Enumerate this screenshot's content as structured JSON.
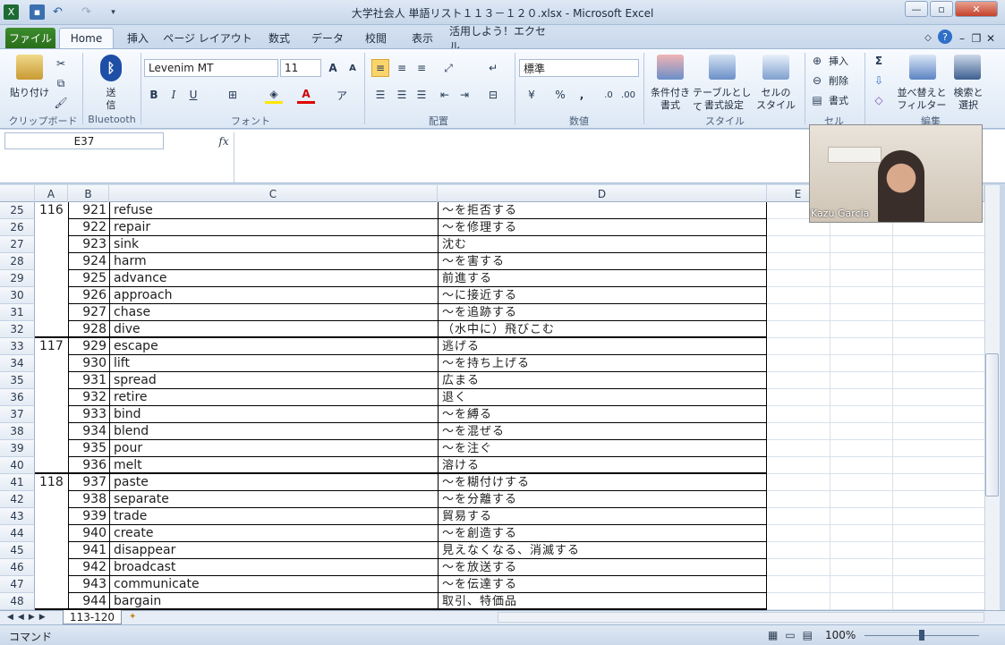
{
  "window": {
    "title": "大学社会人  単語リスト１１３－１２０.xlsx  -  Microsoft Excel"
  },
  "ribbon_tabs": [
    "ファイル",
    "Home",
    "挿入",
    "ページ レイアウト",
    "数式",
    "データ",
    "校閲",
    "表示",
    "活用しよう！エクセル"
  ],
  "ribbon": {
    "clipboard": {
      "paste_label": "貼り付け",
      "group_label": "クリップボード"
    },
    "bluetooth": {
      "send_label1": "送",
      "send_label2": "信",
      "group_label": "Bluetooth"
    },
    "font": {
      "name": "Levenim MT",
      "size": "11",
      "bold": "B",
      "italic": "I",
      "underline": "U",
      "grow": "A",
      "shrink": "A",
      "group_label": "フォント"
    },
    "alignment": {
      "group_label": "配置"
    },
    "number": {
      "format": "標準",
      "percent": "%",
      "comma": ",",
      "group_label": "数値"
    },
    "styles": {
      "conditional1": "条件付き",
      "conditional2": "書式",
      "table1": "テーブルとして",
      "table2": "書式設定",
      "cell1": "セルの",
      "cell2": "スタイル",
      "group_label": "スタイル"
    },
    "cells": {
      "insert": "挿入",
      "delete": "削除",
      "format": "書式",
      "group_label": "セル"
    },
    "editing": {
      "sigma": "Σ",
      "sort1": "並べ替えと",
      "sort2": "フィルター",
      "find1": "検索と",
      "find2": "選択",
      "group_label": "編集"
    }
  },
  "formula_bar": {
    "name_box": "E37",
    "fx": "fx",
    "value": ""
  },
  "columns": [
    "A",
    "B",
    "C",
    "D",
    "E"
  ],
  "rows": [
    {
      "r": "25",
      "a": "116",
      "b": "921",
      "c": "refuse",
      "d": "～を拒否する"
    },
    {
      "r": "26",
      "a": "",
      "b": "922",
      "c": "repair",
      "d": "～を修理する"
    },
    {
      "r": "27",
      "a": "",
      "b": "923",
      "c": "sink",
      "d": "沈む"
    },
    {
      "r": "28",
      "a": "",
      "b": "924",
      "c": "harm",
      "d": "～を害する"
    },
    {
      "r": "29",
      "a": "",
      "b": "925",
      "c": "advance",
      "d": "前進する"
    },
    {
      "r": "30",
      "a": "",
      "b": "926",
      "c": "approach",
      "d": "～に接近する"
    },
    {
      "r": "31",
      "a": "",
      "b": "927",
      "c": "chase",
      "d": "～を追跡する"
    },
    {
      "r": "32",
      "a": "",
      "b": "928",
      "c": "dive",
      "d": "（水中に）飛びこむ"
    },
    {
      "r": "33",
      "a": "117",
      "b": "929",
      "c": "escape",
      "d": "逃げる"
    },
    {
      "r": "34",
      "a": "",
      "b": "930",
      "c": "lift",
      "d": "～を持ち上げる"
    },
    {
      "r": "35",
      "a": "",
      "b": "931",
      "c": "spread",
      "d": "広まる"
    },
    {
      "r": "36",
      "a": "",
      "b": "932",
      "c": "retire",
      "d": "退く"
    },
    {
      "r": "37",
      "a": "",
      "b": "933",
      "c": "bind",
      "d": "～を縛る"
    },
    {
      "r": "38",
      "a": "",
      "b": "934",
      "c": "blend",
      "d": "～を混ぜる"
    },
    {
      "r": "39",
      "a": "",
      "b": "935",
      "c": "pour",
      "d": "～を注ぐ"
    },
    {
      "r": "40",
      "a": "",
      "b": "936",
      "c": "melt",
      "d": "溶ける"
    },
    {
      "r": "41",
      "a": "118",
      "b": "937",
      "c": "paste",
      "d": "～を糊付けする"
    },
    {
      "r": "42",
      "a": "",
      "b": "938",
      "c": "separate",
      "d": "～を分離する"
    },
    {
      "r": "43",
      "a": "",
      "b": "939",
      "c": "trade",
      "d": "貿易する"
    },
    {
      "r": "44",
      "a": "",
      "b": "940",
      "c": "create",
      "d": "～を創造する"
    },
    {
      "r": "45",
      "a": "",
      "b": "941",
      "c": "disappear",
      "d": "見えなくなる、消滅する"
    },
    {
      "r": "46",
      "a": "",
      "b": "942",
      "c": "broadcast",
      "d": "～を放送する"
    },
    {
      "r": "47",
      "a": "",
      "b": "943",
      "c": "communicate",
      "d": "～を伝達する"
    },
    {
      "r": "48",
      "a": "",
      "b": "944",
      "c": "bargain",
      "d": "取引、特価品"
    }
  ],
  "sheet_tab": "113-120",
  "status": {
    "mode": "コマンド",
    "zoom": "100%"
  },
  "webcam": {
    "name": "Kazu Garcia"
  },
  "colors": {
    "file_tab": "#2a6e1c",
    "excel_green": "#1d6b34"
  }
}
